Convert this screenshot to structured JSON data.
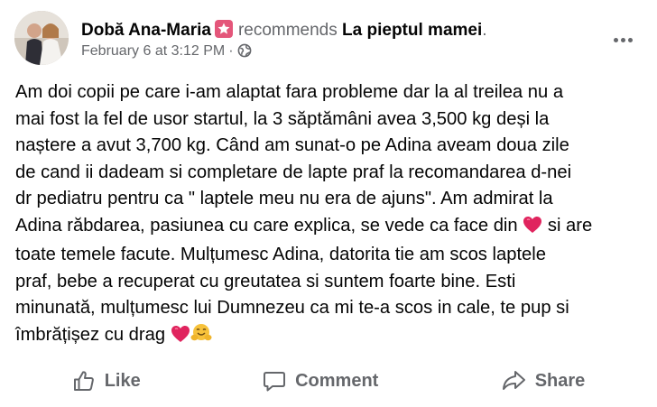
{
  "post": {
    "author": "Dobă Ana-Maria",
    "verb": "recommends",
    "page_name": "La pieptul mamei",
    "page_suffix": ".",
    "timestamp": "February 6 at 3:12 PM",
    "separator": "·",
    "privacy_icon": "globe-icon",
    "badge_icon": "star-recommend-icon",
    "text_lines": [
      "Am doi copii pe care i-am alaptat fara probleme dar la al treilea nu a",
      "mai fost la fel de usor startul, la 3 săptămâni avea 3,500 kg deși la",
      "naștere a avut 3,700 kg. Când am sunat-o pe Adina aveam doua zile",
      "de cand ii dadeam si completare de lapte praf la recomandarea d-nei",
      "dr pediatru pentru ca \" laptele meu nu era de ajuns\". Am admirat la"
    ],
    "line6_before": "Adina răbdarea, pasiunea cu care explica, se vede ca face din",
    "line6_after": "si are",
    "line7": "toate temele facute. Mulțumesc Adina, datorita tie am scos laptele",
    "line8": "praf, bebe a recuperat cu greutatea si suntem foarte bine. Esti",
    "line9": "minunată, mulțumesc lui Dumnezeu ca mi te-a scos in cale, te pup si",
    "line10": "îmbrățișez cu drag"
  },
  "actions": {
    "like": "Like",
    "comment": "Comment",
    "share": "Share"
  },
  "colors": {
    "text": "#050505",
    "secondary": "#65676b",
    "badge": "#e4567a",
    "heart": "#e0245e"
  }
}
